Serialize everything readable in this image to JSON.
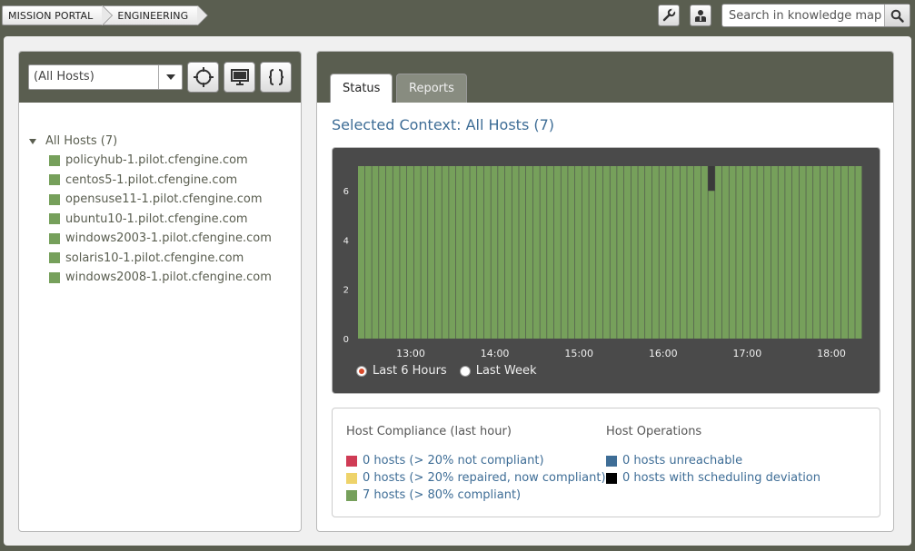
{
  "breadcrumb": {
    "items": [
      "MISSION PORTAL",
      "ENGINEERING"
    ]
  },
  "search": {
    "placeholder": "Search in knowledge map"
  },
  "left": {
    "select_value": "(All Hosts)",
    "tree_root": "All Hosts (7)",
    "hosts": [
      "policyhub-1.pilot.cfengine.com",
      "centos5-1.pilot.cfengine.com",
      "opensuse11-1.pilot.cfengine.com",
      "ubuntu10-1.pilot.cfengine.com",
      "windows2003-1.pilot.cfengine.com",
      "solaris10-1.pilot.cfengine.com",
      "windows2008-1.pilot.cfengine.com"
    ]
  },
  "right": {
    "tabs": [
      "Status",
      "Reports"
    ],
    "context_title": "Selected Context: All Hosts (7)",
    "time_options": [
      "Last 6 Hours",
      "Last Week"
    ],
    "selected_time_option": "Last 6 Hours",
    "compliance": {
      "title": "Host Compliance (last hour)",
      "items": [
        {
          "label": "0 hosts (> 20% not compliant)",
          "color": "#cf3b55"
        },
        {
          "label": "0 hosts (> 20% repaired, now compliant)",
          "color": "#eed36a"
        },
        {
          "label": "7 hosts (> 80% compliant)",
          "color": "#76a05b"
        }
      ]
    },
    "operations": {
      "title": "Host Operations",
      "items": [
        {
          "label": "0 hosts unreachable",
          "color": "#3e6d96"
        },
        {
          "label": "0 hosts with scheduling deviation",
          "color": "#000000"
        }
      ]
    }
  },
  "chart_data": {
    "type": "bar",
    "stacked": true,
    "x_tick_labels": [
      "13:00",
      "14:00",
      "15:00",
      "16:00",
      "17:00",
      "18:00"
    ],
    "y_ticks": [
      0,
      2,
      4,
      6
    ],
    "ylim": [
      0,
      7
    ],
    "bar_count": 72,
    "series": [
      {
        "name": "compliant",
        "color": "#76a05b",
        "values": [
          7,
          7,
          7,
          7,
          7,
          7,
          7,
          7,
          7,
          7,
          7,
          7,
          7,
          7,
          7,
          7,
          7,
          7,
          7,
          7,
          7,
          7,
          7,
          7,
          7,
          7,
          7,
          7,
          7,
          7,
          7,
          7,
          7,
          7,
          7,
          7,
          7,
          7,
          7,
          7,
          7,
          7,
          7,
          7,
          7,
          7,
          7,
          7,
          7,
          7,
          6,
          7,
          7,
          7,
          7,
          7,
          7,
          7,
          7,
          7,
          7,
          7,
          7,
          7,
          7,
          7,
          7,
          7,
          7,
          7,
          7,
          7
        ]
      },
      {
        "name": "scheduling deviation",
        "color": "#3a3a3a",
        "values": [
          0,
          0,
          0,
          0,
          0,
          0,
          0,
          0,
          0,
          0,
          0,
          0,
          0,
          0,
          0,
          0,
          0,
          0,
          0,
          0,
          0,
          0,
          0,
          0,
          0,
          0,
          0,
          0,
          0,
          0,
          0,
          0,
          0,
          0,
          0,
          0,
          0,
          0,
          0,
          0,
          0,
          0,
          0,
          0,
          0,
          0,
          0,
          0,
          0,
          0,
          1,
          0,
          0,
          0,
          0,
          0,
          0,
          0,
          0,
          0,
          0,
          0,
          0,
          0,
          0,
          0,
          0,
          0,
          0,
          0,
          0,
          0
        ]
      }
    ],
    "grid": false,
    "background": "#4a4a4a"
  }
}
